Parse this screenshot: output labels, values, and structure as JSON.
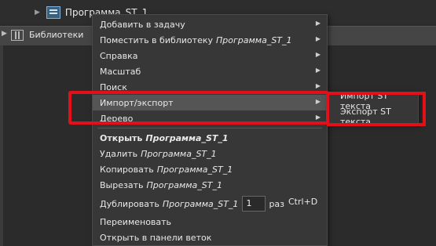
{
  "tree": {
    "program_label": "Программа_ST_1",
    "libraries_label": "Библиотеки"
  },
  "menu": {
    "add_to_task": "Добавить в задачу",
    "place_in_library": "Поместить в библиотеку",
    "place_in_library_target": "Программа_ST_1",
    "help": "Справка",
    "scale": "Масштаб",
    "search": "Поиск",
    "import_export": "Импорт/экспорт",
    "tree": "Дерево",
    "open": "Открыть",
    "open_target": "Программа_ST_1",
    "delete": "Удалить",
    "delete_target": "Программа_ST_1",
    "copy": "Копировать",
    "copy_target": "Программа_ST_1",
    "cut": "Вырезать",
    "cut_target": "Программа_ST_1",
    "duplicate": "Дублировать",
    "duplicate_target": "Программа_ST_1",
    "duplicate_count": "1",
    "duplicate_times": "раз",
    "duplicate_shortcut": "Ctrl+D",
    "rename": "Переименовать",
    "open_in_branch_panel": "Открыть в панели веток"
  },
  "submenu": {
    "import_st": "Импорт ST текста",
    "export_st": "Экспорт ST текста"
  },
  "icons": {
    "submenu_arrow": "chevron-right-icon",
    "expand_arrow": "chevron-right-icon"
  },
  "colors": {
    "annotation_red": "#e3101a",
    "menu_bg": "#373737",
    "highlight_bg": "#555555"
  }
}
